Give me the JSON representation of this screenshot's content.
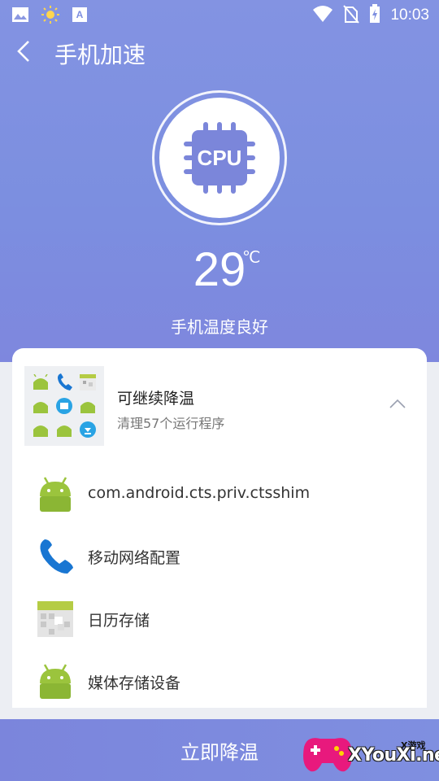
{
  "status_bar": {
    "time": "10:03",
    "left_icons": [
      "image-icon",
      "sun-icon",
      "keyboard-a-icon"
    ],
    "right_icons": [
      "wifi-icon",
      "no-sim-icon",
      "battery-charging-icon"
    ]
  },
  "header": {
    "title": "手机加速",
    "back_icon": "back-arrow-icon"
  },
  "cpu": {
    "chip_label": "CPU",
    "temperature": "29",
    "unit": "℃",
    "status": "手机温度良好"
  },
  "group": {
    "title": "可继续降温",
    "subtitle": "清理57个运行程序",
    "expanded": true
  },
  "apps": [
    {
      "name": "com.android.cts.priv.ctsshim",
      "icon": "android-icon"
    },
    {
      "name": "移动网络配置",
      "icon": "phone-icon"
    },
    {
      "name": "日历存储",
      "icon": "calendar-storage-icon"
    },
    {
      "name": "媒体存储设备",
      "icon": "android-icon"
    }
  ],
  "action": {
    "cool_down_label": "立即降温"
  },
  "watermark": {
    "sub": "X游戏",
    "main": "XYouXi.net"
  },
  "colors": {
    "hero": "#7e8fe0",
    "chip": "#7b86da",
    "android_green": "#9bc43d",
    "phone_blue": "#1976d2"
  }
}
